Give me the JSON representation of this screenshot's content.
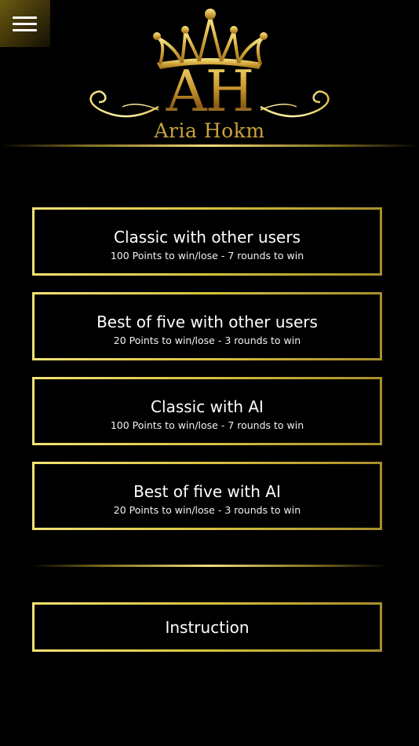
{
  "header": {
    "menu_icon": "hamburger-menu-icon",
    "logo": {
      "monogram": "AH",
      "wordmark": "Aria Hokm",
      "crown_icon": "crown-icon"
    }
  },
  "modes": [
    {
      "title": "Classic with other users",
      "subtitle": "100 Points to win/lose - 7 rounds to win"
    },
    {
      "title": "Best of five with other users",
      "subtitle": "20 Points to win/lose - 3 rounds to win"
    },
    {
      "title": "Classic with AI",
      "subtitle": "100 Points to win/lose - 7 rounds to win"
    },
    {
      "title": "Best of five with AI",
      "subtitle": "20 Points to win/lose - 3 rounds to win"
    }
  ],
  "instruction": {
    "label": "Instruction"
  },
  "colors": {
    "background": "#000000",
    "gold": "#E6CF4E",
    "text": "#FFFFFF"
  }
}
